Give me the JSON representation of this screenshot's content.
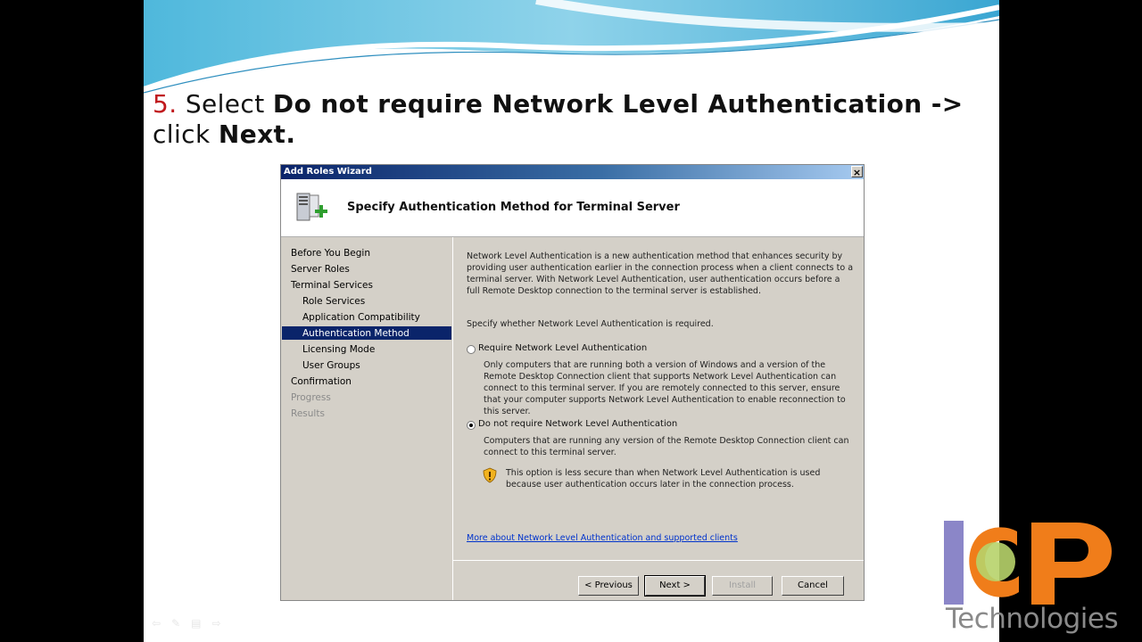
{
  "slide": {
    "step_number": "5.",
    "instruction_prefix": "Select",
    "instruction_bold": "Do not require Network Level Authentication ->",
    "instruction_line2_prefix": "click",
    "instruction_line2_bold": "Next."
  },
  "wizard": {
    "title": "Add Roles Wizard",
    "close_label": "×",
    "heading": "Specify Authentication Method for Terminal Server",
    "nav": [
      {
        "label": "Before You Begin"
      },
      {
        "label": "Server Roles"
      },
      {
        "label": "Terminal Services"
      },
      {
        "label": "Role Services"
      },
      {
        "label": "Application Compatibility"
      },
      {
        "label": "Authentication Method"
      },
      {
        "label": "Licensing Mode"
      },
      {
        "label": "User Groups"
      },
      {
        "label": "Confirmation"
      },
      {
        "label": "Progress"
      },
      {
        "label": "Results"
      }
    ],
    "intro": "Network Level Authentication is a new authentication method that enhances security by providing user authentication earlier in the connection process when a client connects to a terminal server. With Network Level Authentication, user authentication occurs before a full Remote Desktop connection to the terminal server is established.",
    "prompt": "Specify whether Network Level Authentication is required.",
    "option1_label": "Require Network Level Authentication",
    "option1_desc": "Only computers that are running both a version of Windows and a version of the Remote Desktop Connection client that supports Network Level Authentication can connect to this terminal server. If you are remotely connected to this server, ensure that your computer supports Network Level Authentication to enable reconnection to this server.",
    "option2_label": "Do not require Network Level Authentication",
    "option2_desc": "Computers that are running any version of the Remote Desktop Connection client can connect to this terminal server.",
    "warning": "This option is less secure than when Network Level Authentication is used because user authentication occurs later in the connection process.",
    "link": "More about Network Level Authentication and supported clients",
    "buttons": {
      "previous": "< Previous",
      "next": "Next >",
      "install": "Install",
      "cancel": "Cancel"
    }
  },
  "logo": {
    "text": "Technologies",
    "letters": "ICP"
  },
  "colors": {
    "accent_red": "#c0181c",
    "selection": "#0a246a",
    "link": "#0033cc"
  }
}
